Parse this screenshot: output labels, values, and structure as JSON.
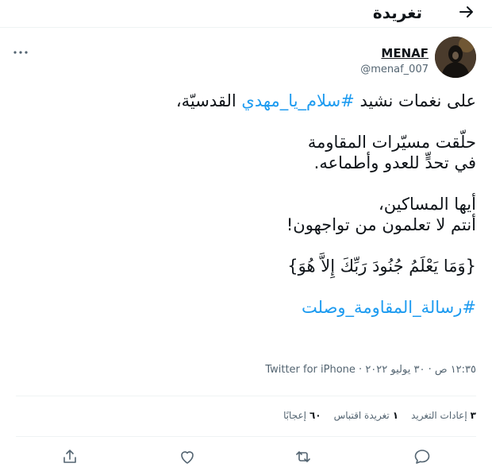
{
  "header": {
    "title": "تغريدة"
  },
  "user": {
    "name": "MENAF",
    "handle": "@menaf_007"
  },
  "tweet": {
    "line1_prefix": "على نغمات نشيد ",
    "line1_hashtag": "#سلام_يا_مهدي",
    "line1_suffix": " القدسيّة،",
    "line2": "حلّقت مسيّرات المقاومة",
    "line3": "في تحدٍّ للعدو وأطماعه.",
    "line4": "أيها المساكين،",
    "line5": "أنتم لا تعلمون من تواجهون!",
    "line6": "{وَمَا يَعْلَمُ جُنُودَ رَبِّكَ إِلاَّ هُوَ}",
    "closing_hashtag": "#رسالة_المقاومة_وصلت"
  },
  "meta": {
    "time_date": "١٢:٣٥ ص · ٣٠ يوليو ٢٠٢٢ · ",
    "source": "Twitter for iPhone"
  },
  "stats": {
    "retweets_count": "٣",
    "retweets_label": "إعادات التغريد",
    "quotes_count": "١",
    "quotes_label": "تغريدة اقتباس",
    "likes_count": "٦٠",
    "likes_label": "إعجابًا"
  },
  "colors": {
    "accent": "#1d9bf0",
    "text": "#0f1419",
    "muted": "#536471",
    "border": "#eff3f4"
  },
  "icons": [
    "back-arrow-icon",
    "more-icon",
    "reply-icon",
    "retweet-icon",
    "like-icon",
    "share-icon"
  ]
}
